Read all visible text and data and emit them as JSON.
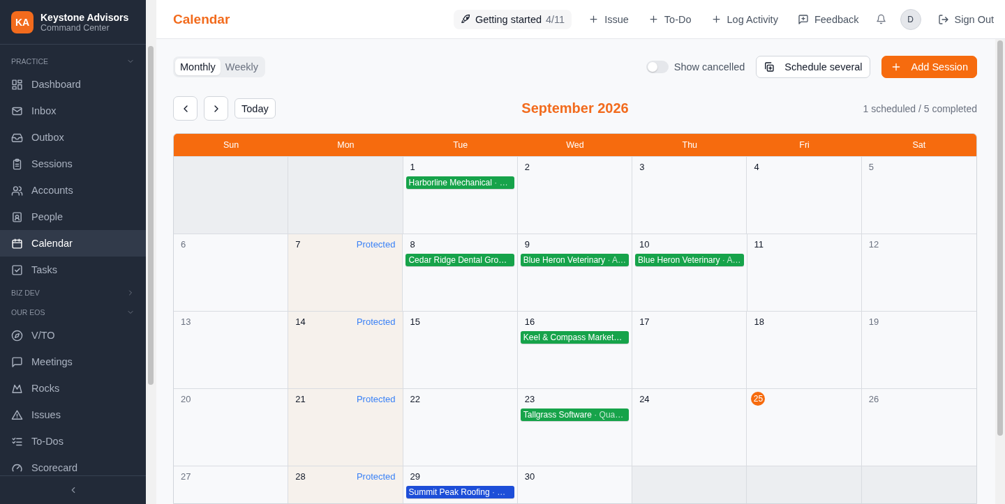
{
  "brand": {
    "logo": "KA",
    "name": "Keystone Advisors",
    "subtitle": "Command Center"
  },
  "sidebar": {
    "sections": [
      {
        "label": "PRACTICE",
        "expanded": true,
        "items": [
          {
            "label": "Dashboard",
            "selected": false
          },
          {
            "label": "Inbox",
            "selected": false
          },
          {
            "label": "Outbox",
            "selected": false
          },
          {
            "label": "Sessions",
            "selected": false
          },
          {
            "label": "Accounts",
            "selected": false
          },
          {
            "label": "People",
            "selected": false
          },
          {
            "label": "Calendar",
            "selected": true
          },
          {
            "label": "Tasks",
            "selected": false
          }
        ]
      },
      {
        "label": "BIZ DEV",
        "expanded": false
      },
      {
        "label": "OUR EOS",
        "expanded": true,
        "items": [
          {
            "label": "V/TO",
            "selected": false
          },
          {
            "label": "Meetings",
            "selected": false
          },
          {
            "label": "Rocks",
            "selected": false
          },
          {
            "label": "Issues",
            "selected": false
          },
          {
            "label": "To-Dos",
            "selected": false
          },
          {
            "label": "Scorecard",
            "selected": false
          }
        ]
      }
    ]
  },
  "topbar": {
    "title": "Calendar",
    "getting_started": {
      "label": "Getting started",
      "progress": "4/11"
    },
    "actions": [
      {
        "kind": "plus",
        "label": "Issue"
      },
      {
        "kind": "plus",
        "label": "To-Do"
      },
      {
        "kind": "plus",
        "label": "Log Activity"
      },
      {
        "kind": "feedback",
        "label": "Feedback"
      }
    ],
    "avatar": "D",
    "sign_out": "Sign Out"
  },
  "toolbar": {
    "views": [
      {
        "label": "Monthly",
        "selected": true
      },
      {
        "label": "Weekly",
        "selected": false
      }
    ],
    "show_cancelled": {
      "label": "Show cancelled",
      "on": false
    },
    "schedule_several": "Schedule several",
    "add_session": "Add Session"
  },
  "nav": {
    "today": "Today",
    "month": "September 2026",
    "summary": "1 scheduled / 5 completed"
  },
  "calendar": {
    "weekdays": [
      "Sun",
      "Mon",
      "Tue",
      "Wed",
      "Thu",
      "Fri",
      "Sat"
    ],
    "weeks": [
      [
        {
          "kind": "outside"
        },
        {
          "kind": "outside"
        },
        {
          "kind": "day",
          "date": "1",
          "today": false,
          "events": [
            {
              "name": "Harborline Mechanical",
              "detail": "· …",
              "color": "#16a34a"
            }
          ]
        },
        {
          "kind": "day",
          "date": "2",
          "today": false
        },
        {
          "kind": "day",
          "date": "3",
          "today": false
        },
        {
          "kind": "day",
          "date": "4",
          "today": false
        },
        {
          "kind": "day",
          "date": "5",
          "today": false
        }
      ],
      [
        {
          "kind": "day",
          "date": "6",
          "today": false
        },
        {
          "kind": "day",
          "date": "7",
          "today": false,
          "note": "Protected"
        },
        {
          "kind": "day",
          "date": "8",
          "today": false,
          "events": [
            {
              "name": "Cedar Ridge Dental Gro…",
              "color": "#16a34a"
            }
          ]
        },
        {
          "kind": "day",
          "date": "9",
          "today": false,
          "events": [
            {
              "name": "Blue Heron Veterinary",
              "detail": "· A…",
              "color": "#16a34a"
            }
          ]
        },
        {
          "kind": "day",
          "date": "10",
          "today": false,
          "events": [
            {
              "name": "Blue Heron Veterinary",
              "detail": "· A…",
              "color": "#16a34a"
            }
          ]
        },
        {
          "kind": "day",
          "date": "11",
          "today": false
        },
        {
          "kind": "day",
          "date": "12",
          "today": false
        }
      ],
      [
        {
          "kind": "day",
          "date": "13",
          "today": false
        },
        {
          "kind": "day",
          "date": "14",
          "today": false,
          "note": "Protected"
        },
        {
          "kind": "day",
          "date": "15",
          "today": false
        },
        {
          "kind": "day",
          "date": "16",
          "today": false,
          "events": [
            {
              "name": "Keel & Compass Market…",
              "color": "#16a34a"
            }
          ]
        },
        {
          "kind": "day",
          "date": "17",
          "today": false
        },
        {
          "kind": "day",
          "date": "18",
          "today": false
        },
        {
          "kind": "day",
          "date": "19",
          "today": false
        }
      ],
      [
        {
          "kind": "day",
          "date": "20",
          "today": false
        },
        {
          "kind": "day",
          "date": "21",
          "today": false,
          "note": "Protected"
        },
        {
          "kind": "day",
          "date": "22",
          "today": false
        },
        {
          "kind": "day",
          "date": "23",
          "today": false,
          "events": [
            {
              "name": "Tallgrass Software",
              "detail": "· Qua…",
              "color": "#16a34a"
            }
          ]
        },
        {
          "kind": "day",
          "date": "24",
          "today": false
        },
        {
          "kind": "day",
          "date": "25",
          "today": true
        },
        {
          "kind": "day",
          "date": "26",
          "today": false
        }
      ],
      [
        {
          "kind": "day",
          "date": "27",
          "today": false
        },
        {
          "kind": "day",
          "date": "28",
          "today": false,
          "note": "Protected"
        },
        {
          "kind": "day",
          "date": "29",
          "today": false,
          "events": [
            {
              "name": "Summit Peak Roofing",
              "detail": "· …",
              "color": "#1d4ed8"
            }
          ]
        },
        {
          "kind": "day",
          "date": "30",
          "today": false
        },
        {
          "kind": "outside"
        },
        {
          "kind": "outside"
        },
        {
          "kind": "outside"
        }
      ]
    ]
  }
}
